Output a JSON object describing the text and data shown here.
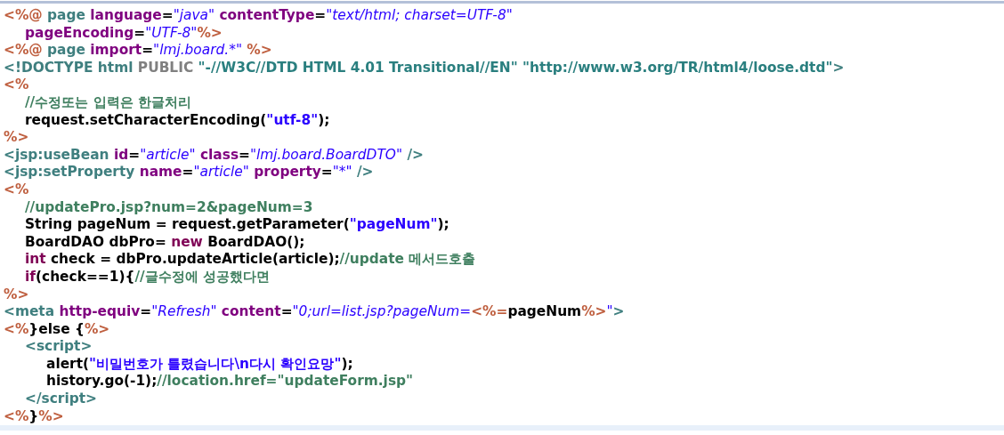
{
  "editor": {
    "lines": [
      {
        "tokens": [
          {
            "kind": "delimiter",
            "text": "<%@"
          },
          {
            "kind": "tag",
            "text": " page "
          },
          {
            "kind": "attribute",
            "text": "language"
          },
          {
            "kind": "plain",
            "text": "="
          },
          {
            "kind": "value",
            "text": "\"java\""
          },
          {
            "kind": "attribute",
            "text": " contentType"
          },
          {
            "kind": "plain",
            "text": "="
          },
          {
            "kind": "value",
            "text": "\"text/html; charset=UTF-8\""
          }
        ]
      },
      {
        "tokens": [
          {
            "kind": "attribute",
            "text": "\tpageEncoding"
          },
          {
            "kind": "plain",
            "text": "="
          },
          {
            "kind": "value",
            "text": "\"UTF-8\""
          },
          {
            "kind": "delimiter",
            "text": "%>"
          }
        ]
      },
      {
        "tokens": [
          {
            "kind": "delimiter",
            "text": "<%@"
          },
          {
            "kind": "tag",
            "text": " page "
          },
          {
            "kind": "attribute",
            "text": "import"
          },
          {
            "kind": "plain",
            "text": "="
          },
          {
            "kind": "value",
            "text": "\"lmj.board.*\""
          },
          {
            "kind": "delimiter",
            "text": " %>"
          }
        ]
      },
      {
        "tokens": [
          {
            "kind": "tag",
            "text": "<!DOCTYPE html "
          },
          {
            "kind": "doctype",
            "text": "PUBLIC "
          },
          {
            "kind": "dtd",
            "text": "\"-//W3C//DTD HTML 4.01 Transitional//EN\" \"http://www.w3.org/TR/html4/loose.dtd\""
          },
          {
            "kind": "tag",
            "text": ">"
          }
        ]
      },
      {
        "tokens": [
          {
            "kind": "delimiter",
            "text": "<%"
          }
        ]
      },
      {
        "tokens": [
          {
            "kind": "comment",
            "text": "\t//수정또는 입력은 한글처리"
          }
        ]
      },
      {
        "tokens": [
          {
            "kind": "plain",
            "text": "\trequest.setCharacterEncoding("
          },
          {
            "kind": "string",
            "text": "\"utf-8\""
          },
          {
            "kind": "plain",
            "text": ");"
          }
        ]
      },
      {
        "tokens": [
          {
            "kind": "delimiter",
            "text": "%>"
          }
        ]
      },
      {
        "tokens": [
          {
            "kind": "tag",
            "text": "<jsp:useBean "
          },
          {
            "kind": "attribute",
            "text": "id"
          },
          {
            "kind": "plain",
            "text": "="
          },
          {
            "kind": "value",
            "text": "\"article\""
          },
          {
            "kind": "attribute",
            "text": " class"
          },
          {
            "kind": "plain",
            "text": "="
          },
          {
            "kind": "value",
            "text": "\"lmj.board.BoardDTO\""
          },
          {
            "kind": "tag",
            "text": " />"
          }
        ]
      },
      {
        "tokens": [
          {
            "kind": "tag",
            "text": "<jsp:setProperty "
          },
          {
            "kind": "attribute",
            "text": "name"
          },
          {
            "kind": "plain",
            "text": "="
          },
          {
            "kind": "value",
            "text": "\"article\""
          },
          {
            "kind": "attribute",
            "text": " property"
          },
          {
            "kind": "plain",
            "text": "="
          },
          {
            "kind": "value",
            "text": "\"*\""
          },
          {
            "kind": "tag",
            "text": " />"
          }
        ]
      },
      {
        "tokens": [
          {
            "kind": "delimiter",
            "text": "<%"
          }
        ]
      },
      {
        "tokens": [
          {
            "kind": "comment",
            "text": "\t//updatePro.jsp?num=2&pageNum=3"
          }
        ]
      },
      {
        "tokens": [
          {
            "kind": "plain",
            "text": "\tString pageNum = request.getParameter("
          },
          {
            "kind": "string",
            "text": "\"pageNum\""
          },
          {
            "kind": "plain",
            "text": ");"
          }
        ]
      },
      {
        "tokens": [
          {
            "kind": "plain",
            "text": "\tBoardDAO dbPro= "
          },
          {
            "kind": "keyword",
            "text": "new"
          },
          {
            "kind": "plain",
            "text": " BoardDAO();"
          }
        ]
      },
      {
        "tokens": [
          {
            "kind": "keyword",
            "text": "\tint"
          },
          {
            "kind": "plain",
            "text": " check = dbPro.updateArticle(article);"
          },
          {
            "kind": "comment",
            "text": "//update 메서드호출"
          }
        ]
      },
      {
        "tokens": [
          {
            "kind": "keyword",
            "text": "\tif"
          },
          {
            "kind": "plain",
            "text": "(check==1){"
          },
          {
            "kind": "comment",
            "text": "//글수정에 성공했다면"
          }
        ]
      },
      {
        "tokens": [
          {
            "kind": "delimiter",
            "text": "%>"
          }
        ]
      },
      {
        "tokens": [
          {
            "kind": "tag",
            "text": "<meta "
          },
          {
            "kind": "attribute",
            "text": "http-equiv"
          },
          {
            "kind": "plain",
            "text": "="
          },
          {
            "kind": "value",
            "text": "\"Refresh\""
          },
          {
            "kind": "attribute",
            "text": " content"
          },
          {
            "kind": "plain",
            "text": "="
          },
          {
            "kind": "value",
            "text": "\"0;url=list.jsp?pageNum="
          },
          {
            "kind": "delimiter",
            "text": "<%="
          },
          {
            "kind": "plain",
            "text": "pageNum"
          },
          {
            "kind": "delimiter",
            "text": "%>"
          },
          {
            "kind": "value",
            "text": "\""
          },
          {
            "kind": "tag",
            "text": ">"
          }
        ]
      },
      {
        "tokens": [
          {
            "kind": "delimiter",
            "text": "<%"
          },
          {
            "kind": "plain",
            "text": "}else {"
          },
          {
            "kind": "delimiter",
            "text": "%>"
          }
        ]
      },
      {
        "tokens": [
          {
            "kind": "tag",
            "text": "\t<script>"
          }
        ]
      },
      {
        "tokens": [
          {
            "kind": "plain",
            "text": "\t\talert("
          },
          {
            "kind": "string",
            "text": "\"비밀번호가 틀렸습니다\\n다시 확인요망\""
          },
          {
            "kind": "plain",
            "text": ");"
          }
        ]
      },
      {
        "tokens": [
          {
            "kind": "plain",
            "text": "\t\thistory.go(-1);"
          },
          {
            "kind": "comment",
            "text": "//location.href=\"updateForm.jsp\""
          }
        ]
      },
      {
        "tokens": [
          {
            "kind": "tag",
            "text": "\t</script>"
          }
        ]
      },
      {
        "tokens": [
          {
            "kind": "delimiter",
            "text": "<%"
          },
          {
            "kind": "plain",
            "text": "}"
          },
          {
            "kind": "delimiter",
            "text": "%>"
          }
        ]
      }
    ]
  }
}
